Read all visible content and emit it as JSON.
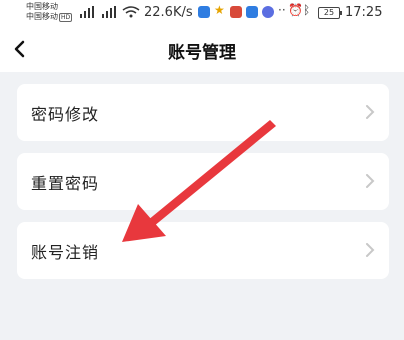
{
  "status_bar": {
    "carrier_1": "中国移动",
    "carrier_2": "中国移动",
    "hd_badge": "HD",
    "net_speed": "22.6K/s",
    "battery": "25",
    "time": "17:25"
  },
  "header": {
    "title": "账号管理"
  },
  "menu": {
    "items": [
      {
        "label": "密码修改"
      },
      {
        "label": "重置密码"
      },
      {
        "label": "账号注销"
      }
    ]
  },
  "colors": {
    "background": "#f0f2f5",
    "card": "#ffffff",
    "annotation_arrow": "#e8383d",
    "chevron": "#c8c8c8"
  }
}
